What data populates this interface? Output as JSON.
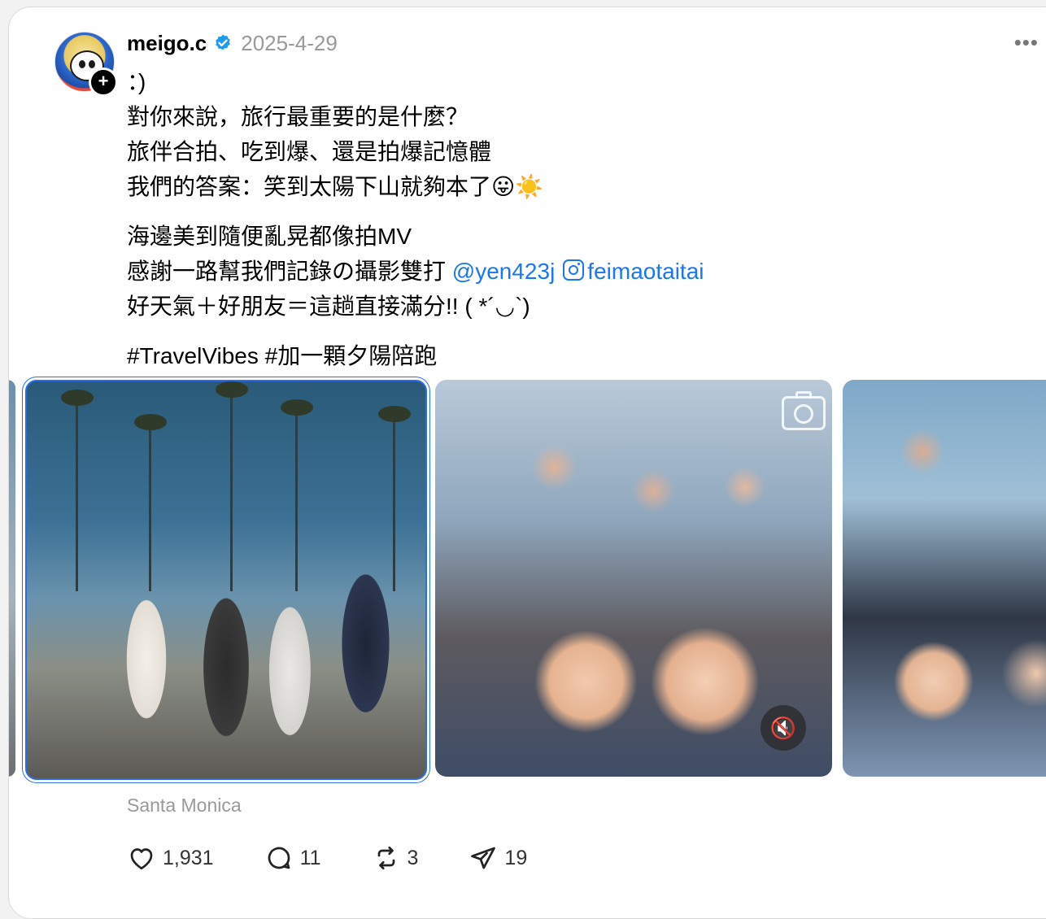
{
  "post": {
    "username": "meigo.c",
    "date": "2025-4-29",
    "more_label": "•••",
    "follow_label": "+",
    "text_lines": [
      "：)",
      "對你來說，旅行最重要的是什麼？",
      "旅伴合拍、吃到爆、還是拍爆記憶體",
      "我們的答案：笑到太陽下山就夠本了😛☀️"
    ],
    "text_lines_2": [
      "海邊美到隨便亂晃都像拍MV"
    ],
    "credit_prefix": "感謝一路幫我們記錄の攝影雙打 ",
    "mention_1": "@yen423j",
    "mention_2": "feimaotaitai",
    "text_lines_3": [
      "好天氣＋好朋友＝這趟直接滿分!! ( *´◡`)"
    ],
    "hashtags": "#TravelVibes #加一顆夕陽陪跑",
    "location": "Santa Monica"
  },
  "stats": {
    "likes": "1,931",
    "replies": "11",
    "reposts": "3",
    "shares": "19"
  },
  "colors": {
    "mention": "#1877f2",
    "verified": "#1d9bf0",
    "selected_border": "#2b6de8"
  },
  "icons": [
    "gear-icon"
  ]
}
